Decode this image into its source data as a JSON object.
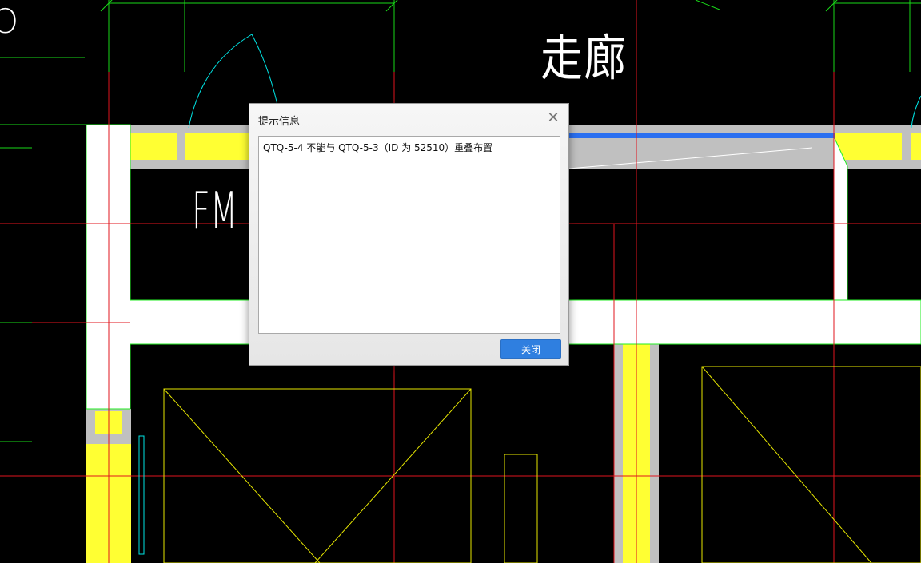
{
  "drawing": {
    "labels": {
      "corridor": "走廊",
      "fm": "FM",
      "partial_o": "O"
    },
    "colors": {
      "background": "#000000",
      "gridline": "#e0141e",
      "dimension_line": "#18d818",
      "wall_fill": "#ffffff",
      "wall_outline": "#22ee22",
      "insulation_fill": "#ffff33",
      "wall_border_gray": "#c0c0c0",
      "opening": "#e6e600",
      "door_arc": "#00e5e5",
      "selected_wall": "#2a6ff0"
    }
  },
  "dialog": {
    "title": "提示信息",
    "close_icon": "close-icon",
    "message": "QTQ-5-4 不能与 QTQ-5-3（ID 为 52510）重叠布置",
    "button_label": "关闭"
  }
}
